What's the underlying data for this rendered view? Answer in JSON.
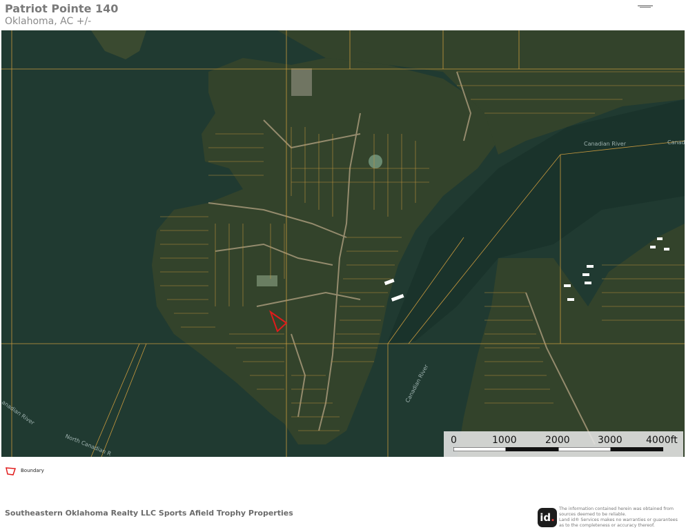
{
  "header": {
    "title": "Patriot Pointe 140",
    "subtitle": "Oklahoma,  AC +/-"
  },
  "map": {
    "labels": {
      "canadian_river_ne": "Canadian River",
      "canadian_ne_edge": "Canadi",
      "canadian_river_south": "Canadian River",
      "canadian_river_west": "anadian River",
      "north_canadian": "North Canadian R"
    },
    "colors": {
      "water": "#203a31",
      "land": "#3a4a2f",
      "parcel_lines": "#c99a3e",
      "boundary": "#e01b1b"
    },
    "scale": {
      "labels": [
        "0",
        "1000",
        "2000",
        "3000",
        "4000ft"
      ]
    }
  },
  "legend": {
    "boundary_label": "Boundary"
  },
  "footer": {
    "company": "Southeastern Oklahoma Realty LLC Sports Afield Trophy Properties",
    "logo_text": "id",
    "disclaimer_line1": "The information contained herein was obtained from",
    "disclaimer_line2": "sources deemed to be reliable.",
    "disclaimer_line3": "Land id® Services makes no warranties or guarantees",
    "disclaimer_line4": "as to the completeness or accuracy thereof."
  }
}
